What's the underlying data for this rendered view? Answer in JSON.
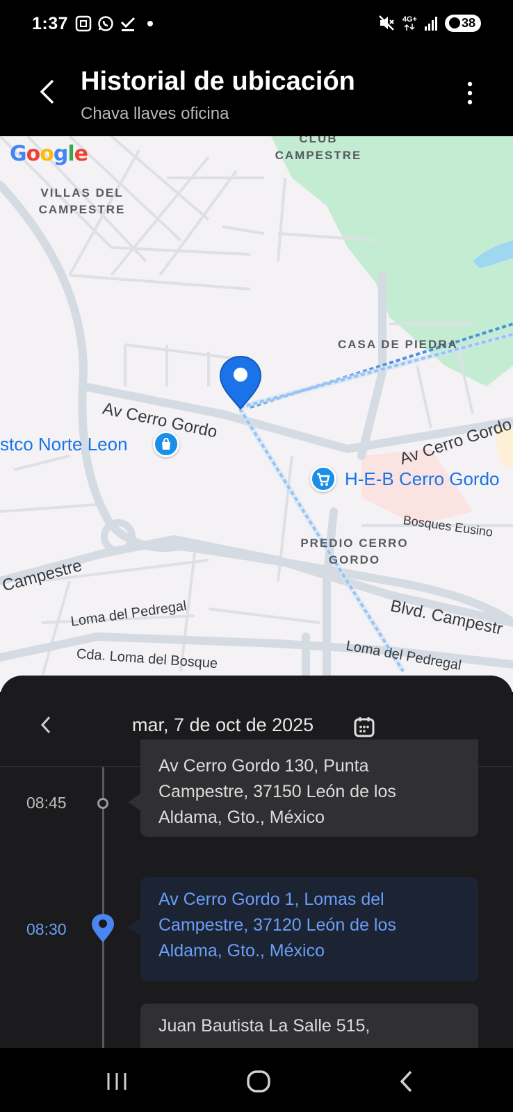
{
  "status_bar": {
    "time": "1:37",
    "network": "4G+",
    "battery": "38"
  },
  "header": {
    "title": "Historial de ubicación",
    "subtitle": "Chava llaves oficina"
  },
  "map": {
    "logo": "Google",
    "areas": {
      "villas": "VILLAS DEL CAMPESTRE",
      "club": "CLUB CAMPESTRE",
      "casa": "CASA DE PIEDRA",
      "predio": "PREDIO CERRO GORDO"
    },
    "streets": {
      "cerro_gordo_left": "Av Cerro Gordo",
      "cerro_gordo_right": "Av Cerro Gordo",
      "campestre_left": "Campestre",
      "campestre_right": "Blvd. Campestr",
      "loma_pedregal_left": "Loma del Pedregal",
      "loma_pedregal_right": "Loma del Pedregal",
      "loma_bosque": "Cda. Loma del Bosque",
      "bosques": "Bosques Eusino"
    },
    "pois": {
      "costco": "stco Norte Leon",
      "heb": "H-E-B Cerro Gordo"
    },
    "colors": {
      "route": "#4a90e2",
      "pin": "#1a73e8",
      "park": "#c3ecd2",
      "water": "#9fd7f0"
    }
  },
  "history": {
    "date": "mar, 7 de oct de 2025",
    "entries": [
      {
        "time": "08:45",
        "address": "Av Cerro Gordo 130, Punta Campestre, 37150 León de los Aldama, Gto., México"
      },
      {
        "time": "08:30",
        "address": "Av Cerro Gordo 1, Lomas del Campestre, 37120 León de los Aldama, Gto., México"
      },
      {
        "time": "",
        "address": "Juan Bautista La Salle 515,"
      }
    ]
  }
}
